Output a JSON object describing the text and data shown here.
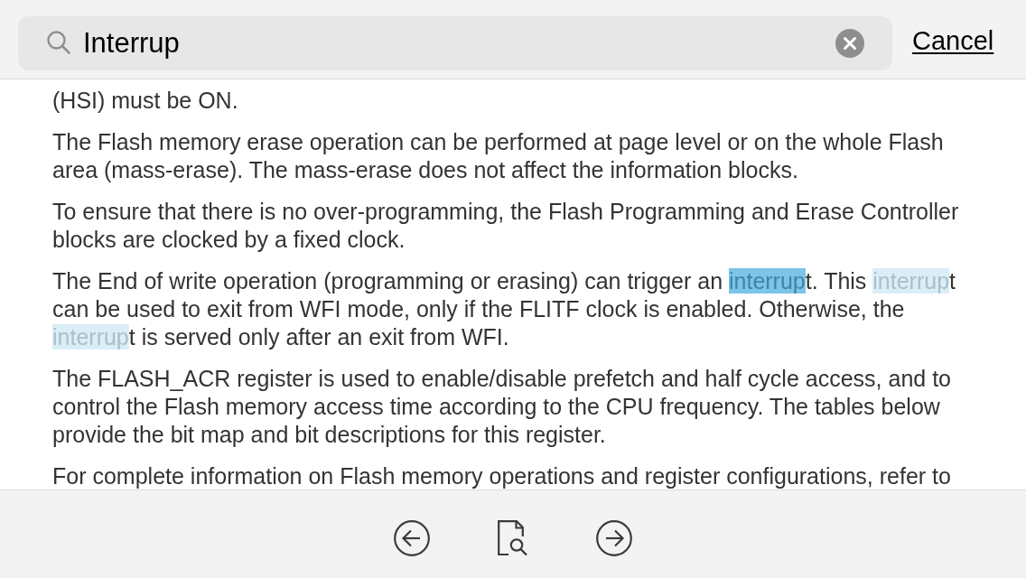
{
  "search": {
    "value": "Interrup",
    "cancel_label": "Cancel"
  },
  "paragraphs": [
    {
      "runs": [
        {
          "kind": "text",
          "text": "(HSI) must be ON."
        }
      ]
    },
    {
      "runs": [
        {
          "kind": "text",
          "text": "The Flash memory erase operation can be performed at page level or on the whole Flash area (mass-erase). The mass-erase does not affect the information blocks."
        }
      ]
    },
    {
      "runs": [
        {
          "kind": "text",
          "text": "To ensure that there is no over-programming, the Flash Programming and Erase Controller blocks are clocked by a fixed clock."
        }
      ]
    },
    {
      "runs": [
        {
          "kind": "text",
          "text": "The End of write operation (programming or erasing) can trigger an "
        },
        {
          "kind": "match",
          "text": "interrup",
          "selected": true
        },
        {
          "kind": "text",
          "text": "t. This "
        },
        {
          "kind": "match",
          "text": "interrup",
          "selected": false
        },
        {
          "kind": "text",
          "text": "t can be used to exit from WFI mode, only if the FLITF clock is enabled. Otherwise, the "
        },
        {
          "kind": "match",
          "text": "interrup",
          "selected": false
        },
        {
          "kind": "text",
          "text": "t is served only after an exit from WFI."
        }
      ]
    },
    {
      "runs": [
        {
          "kind": "text",
          "text": "The FLASH_ACR register is used to enable/disable prefetch and half cycle access, and to control the Flash memory access time according to the CPU frequency. The tables below provide the bit map and bit descriptions for this register."
        }
      ]
    },
    {
      "runs": [
        {
          "kind": "text",
          "text": "For complete information on Flash memory operations and register configurations, refer to"
        }
      ]
    }
  ]
}
